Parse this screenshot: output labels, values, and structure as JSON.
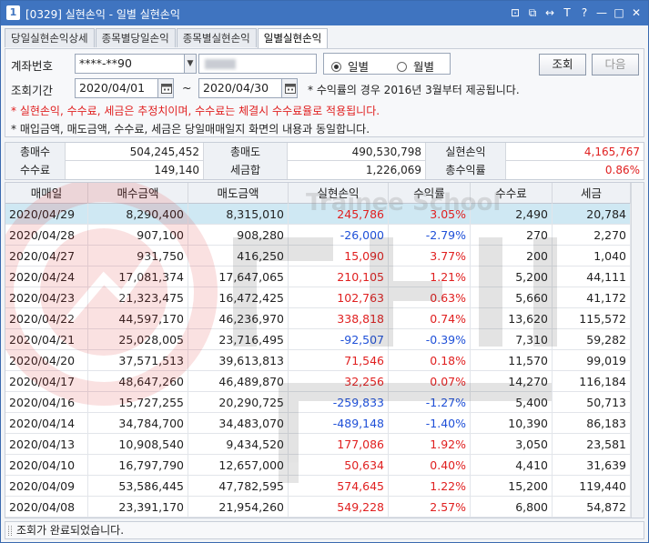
{
  "window": {
    "number_badge": "1",
    "title": "[0329] 실현손익 - 일별 실현손익",
    "controls": [
      "⊡",
      "⧉",
      "↔",
      "T",
      "?",
      "—",
      "□",
      "✕"
    ]
  },
  "tabs": [
    {
      "label": "당일실현손익상세",
      "active": false
    },
    {
      "label": "종목별당일손익",
      "active": false
    },
    {
      "label": "종목별실현손익",
      "active": false
    },
    {
      "label": "일별실현손익",
      "active": true
    }
  ],
  "form": {
    "account_label": "계좌번호",
    "account_value": "****-**90",
    "period_label": "조회기간",
    "start_date": "2020/04/01",
    "tilde": "~",
    "end_date": "2020/04/30",
    "radio_daily": "일별",
    "radio_monthly": "월별",
    "selected": "daily",
    "search_button": "조회",
    "next_button": "다음",
    "notice_period": "* 수익률의 경우 2016년 3월부터 제공됩니다.",
    "notice_estimate": "* 실현손익, 수수료, 세금은 추정치이며, 수수료는 체결시 수수료율로 적용됩니다.",
    "notice_daily": "* 매입금액, 매도금액, 수수료, 세금은 당일매매일지 화면의 내용과 동일합니다."
  },
  "summary": {
    "total_buy_label": "총매수",
    "total_buy": "504,245,452",
    "total_sell_label": "총매도",
    "total_sell": "490,530,798",
    "realized_label": "실현손익",
    "realized": "4,165,767",
    "fee_label": "수수료",
    "fee": "149,140",
    "tax_label": "세금합",
    "tax": "1,226,069",
    "total_return_label": "총수익률",
    "total_return": "0.86%"
  },
  "table": {
    "headers": [
      "매매일",
      "매수금액",
      "매도금액",
      "실현손익",
      "수익률",
      "수수료",
      "세금"
    ],
    "rows": [
      [
        "2020/04/29",
        "8,290,400",
        "8,315,010",
        "245,786",
        "3.05%",
        "2,490",
        "20,784"
      ],
      [
        "2020/04/28",
        "907,100",
        "908,280",
        "-26,000",
        "-2.79%",
        "270",
        "2,270"
      ],
      [
        "2020/04/27",
        "931,750",
        "416,250",
        "15,090",
        "3.77%",
        "200",
        "1,040"
      ],
      [
        "2020/04/24",
        "17,081,374",
        "17,647,065",
        "210,105",
        "1.21%",
        "5,200",
        "44,111"
      ],
      [
        "2020/04/23",
        "21,323,475",
        "16,472,425",
        "102,763",
        "0.63%",
        "5,660",
        "41,172"
      ],
      [
        "2020/04/22",
        "44,597,170",
        "46,236,970",
        "338,818",
        "0.74%",
        "13,620",
        "115,572"
      ],
      [
        "2020/04/21",
        "25,028,005",
        "23,716,495",
        "-92,507",
        "-0.39%",
        "7,310",
        "59,282"
      ],
      [
        "2020/04/20",
        "37,571,513",
        "39,613,813",
        "71,546",
        "0.18%",
        "11,570",
        "99,019"
      ],
      [
        "2020/04/17",
        "48,647,260",
        "46,489,870",
        "32,256",
        "0.07%",
        "14,270",
        "116,184"
      ],
      [
        "2020/04/16",
        "15,727,255",
        "20,290,725",
        "-259,833",
        "-1.27%",
        "5,400",
        "50,713"
      ],
      [
        "2020/04/14",
        "34,784,700",
        "34,483,070",
        "-489,148",
        "-1.40%",
        "10,390",
        "86,183"
      ],
      [
        "2020/04/13",
        "10,908,540",
        "9,434,520",
        "177,086",
        "1.92%",
        "3,050",
        "23,581"
      ],
      [
        "2020/04/10",
        "16,797,790",
        "12,657,000",
        "50,634",
        "0.40%",
        "4,410",
        "31,639"
      ],
      [
        "2020/04/09",
        "53,586,445",
        "47,782,595",
        "574,645",
        "1.22%",
        "15,200",
        "119,440"
      ],
      [
        "2020/04/08",
        "23,391,170",
        "21,954,260",
        "549,228",
        "2.57%",
        "6,800",
        "54,872"
      ]
    ]
  },
  "watermark_text": "Trainee School",
  "status": "조회가 완료되었습니다.",
  "colors": {
    "title_bar": "#3f74c0",
    "positive": "#e02020",
    "negative": "#1f50d8",
    "selected_row": "#cfe8f3"
  }
}
